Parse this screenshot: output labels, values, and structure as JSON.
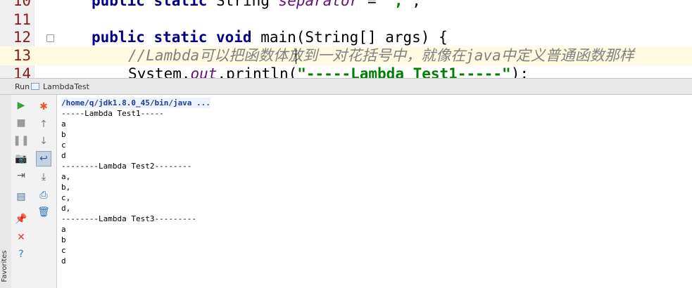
{
  "editor": {
    "lines": [
      {
        "num": "10",
        "kind": "separator",
        "kw": "public static",
        "type": "String ",
        "field": "separator",
        "op": " = ",
        "str": "\",\"",
        "end": ";"
      },
      {
        "num": "11",
        "kind": "blank"
      },
      {
        "num": "12",
        "kind": "main",
        "kw1": "public static void",
        "rest": " main(String[] args) {"
      },
      {
        "num": "13",
        "kind": "comment",
        "text": "//Lambda可以把函数体放到一对花括号中，就像在java中定义普通函数那样"
      },
      {
        "num": "14",
        "kind": "println",
        "pre": "System.",
        "field": "out",
        "call": ".println(",
        "str": "\"-----Lambda Test1-----\"",
        "end": ");"
      }
    ]
  },
  "run_panel": {
    "header_label": "Run",
    "config_name": "LambdaTest",
    "favorites_label": "Favorites",
    "left_toolbar": [
      {
        "name": "rerun-icon",
        "glyph": "▶",
        "color": "#3aa03a"
      },
      {
        "name": "stop-icon",
        "glyph": "■",
        "color": "#9a9a9a"
      },
      {
        "name": "pause-icon",
        "glyph": "❚❚",
        "color": "#9a9a9a"
      },
      {
        "name": "dump-threads-icon",
        "glyph": "📷",
        "color": "#777777"
      },
      {
        "name": "exit-icon",
        "glyph": "⇥",
        "color": "#555555"
      },
      {
        "name": "restore-layout-icon",
        "glyph": "▤",
        "color": "#4a6fa5"
      },
      {
        "name": "pin-icon",
        "glyph": "📌",
        "color": "#8a5fb0"
      },
      {
        "name": "close-icon",
        "glyph": "✕",
        "color": "#d93b3b"
      },
      {
        "name": "help-icon",
        "glyph": "?",
        "color": "#3a7bd5"
      }
    ],
    "right_toolbar": [
      {
        "name": "debug-settings-icon",
        "glyph": "✱",
        "color": "#e06020"
      },
      {
        "name": "up-arrow-icon",
        "glyph": "↑",
        "color": "#7d7d7d"
      },
      {
        "name": "down-arrow-icon",
        "glyph": "↓",
        "color": "#7d7d7d"
      },
      {
        "name": "soft-wrap-icon",
        "glyph": "↩",
        "color": "#3b5c88",
        "selected": true
      },
      {
        "name": "scroll-to-end-icon",
        "glyph": "⤓",
        "color": "#555555"
      },
      {
        "name": "print-icon",
        "glyph": "⎙",
        "color": "#2f6fb0"
      },
      {
        "name": "clear-all-icon",
        "glyph": "🗑",
        "color": "#2f6fb0"
      }
    ],
    "console_lines": [
      "/home/q/jdk1.8.0_45/bin/java ...",
      "-----Lambda Test1-----",
      "a",
      "b",
      "c",
      "d",
      "--------Lambda Test2--------",
      "a,",
      "b,",
      "c,",
      "d,",
      "--------Lambda Test3---------",
      "a",
      "b",
      "c",
      "d"
    ]
  }
}
